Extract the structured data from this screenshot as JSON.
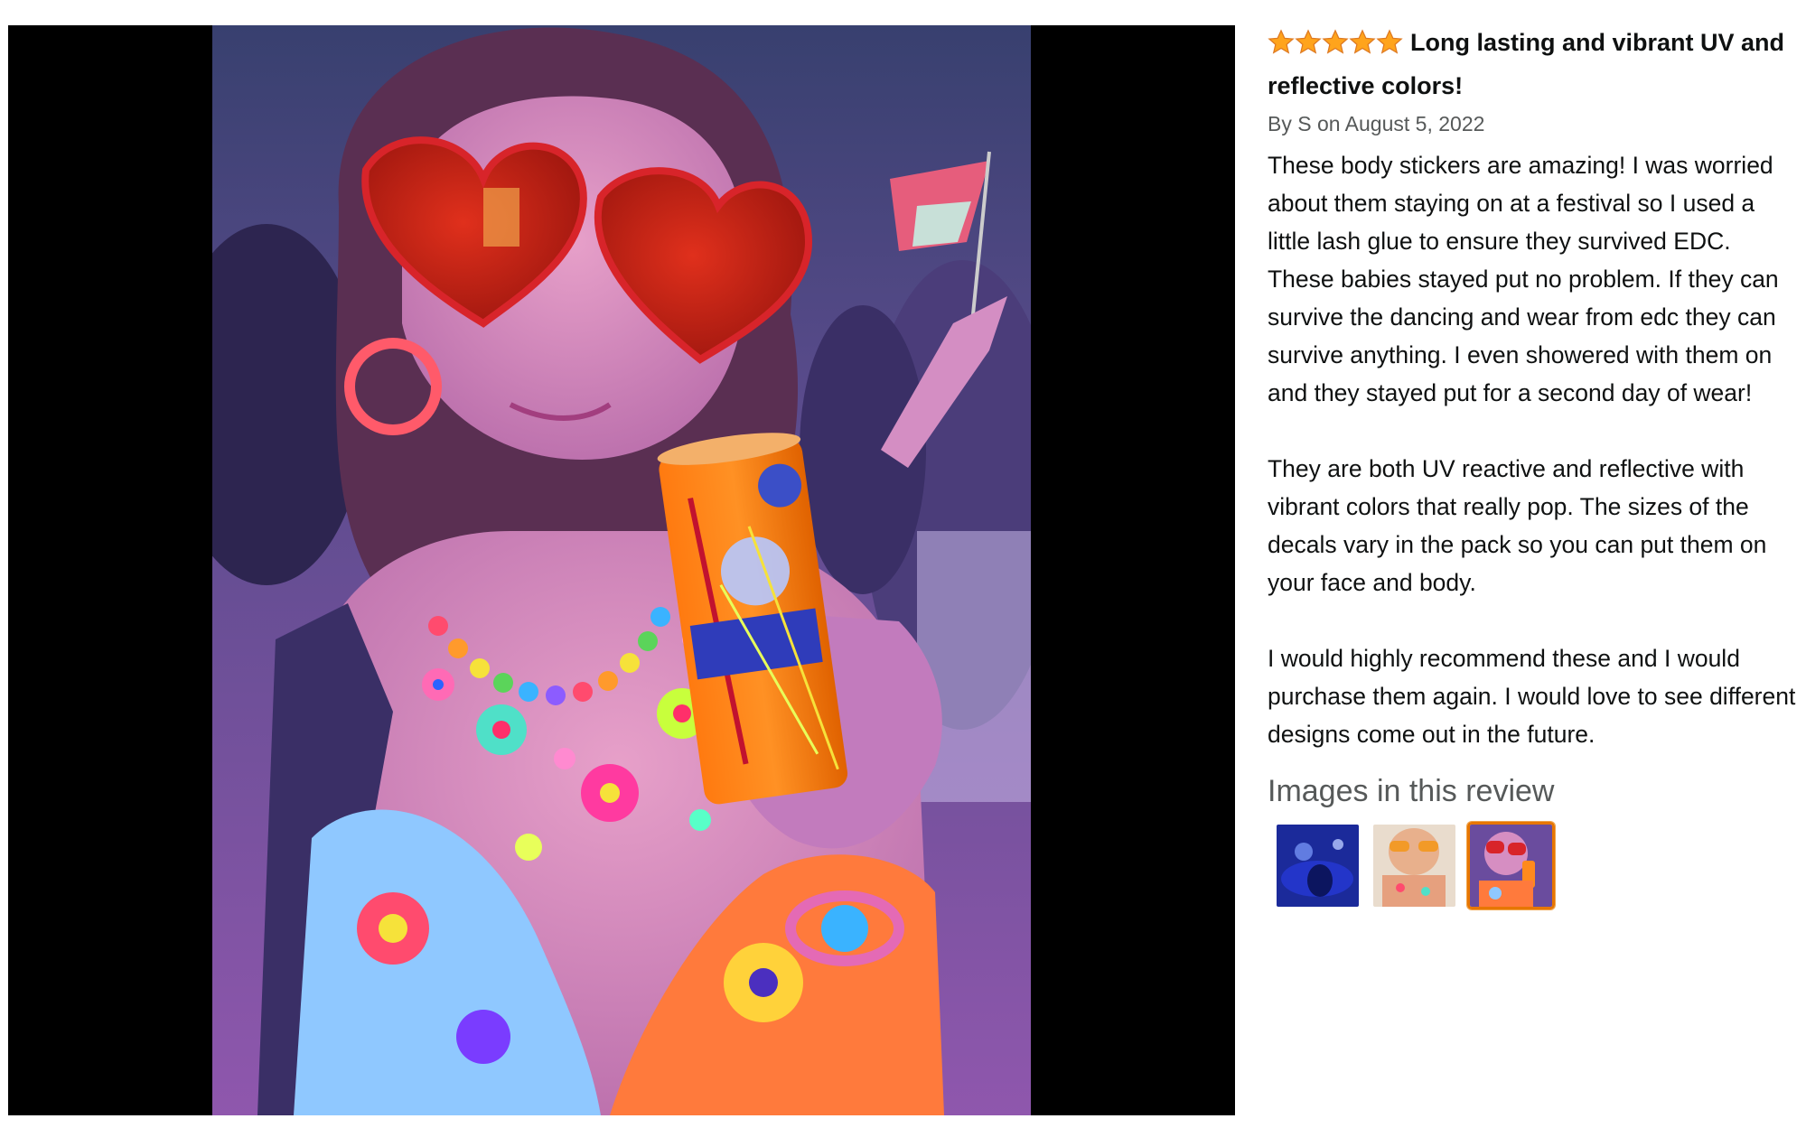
{
  "review": {
    "rating": 5,
    "rating_max": 5,
    "title": "Long lasting and vibrant UV and reflective colors!",
    "byline": "By S on August 5, 2022",
    "paragraphs": [
      "These body stickers are amazing! I was worried about them staying on at a festival so I used a little lash glue to ensure they survived EDC. These babies stayed put no problem. If they can survive the dancing and wear from edc they can survive anything. I even showered with them on and they stayed put for a second day of wear!",
      "They are both UV reactive and reflective with vibrant colors that really pop. The sizes of the decals vary in the pack so you can put them on your face and body.",
      "I would highly recommend these and I would purchase them again. I would love to see different designs come out in the future."
    ]
  },
  "images_section": {
    "heading": "Images in this review",
    "thumbnails": [
      {
        "name": "thumbnail-1",
        "selected": false
      },
      {
        "name": "thumbnail-2",
        "selected": false
      },
      {
        "name": "thumbnail-3",
        "selected": true
      }
    ]
  },
  "colors": {
    "star": "#ffa41c",
    "star_outline": "#de7921",
    "selected_border": "#e77600",
    "viewer_bg": "#000000",
    "byline": "#565959",
    "text": "#0f1111"
  },
  "icons": {
    "star": "star-icon"
  }
}
